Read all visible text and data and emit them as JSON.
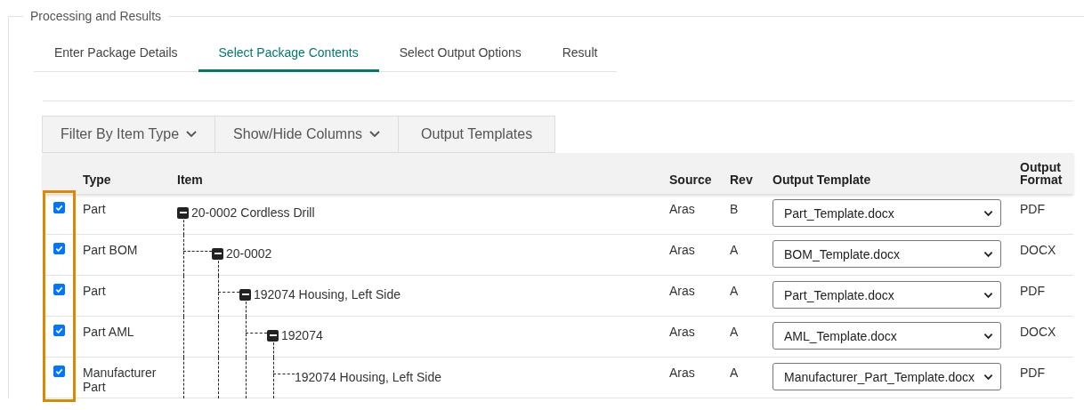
{
  "section": {
    "title": "Processing and Results"
  },
  "tabs": [
    {
      "label": "Enter Package Details",
      "selected": false
    },
    {
      "label": "Select Package Contents",
      "selected": true
    },
    {
      "label": "Select Output Options",
      "selected": false
    },
    {
      "label": "Result",
      "selected": false
    }
  ],
  "toolbar": [
    {
      "label": "Filter By Item Type",
      "dropdown": true
    },
    {
      "label": "Show/Hide Columns",
      "dropdown": true
    },
    {
      "label": "Output Templates",
      "dropdown": false
    }
  ],
  "table": {
    "columns": [
      "Type",
      "Item",
      "Source",
      "Rev",
      "Output Template",
      "Output Format"
    ],
    "tree": [
      {
        "checked": true,
        "type": "Part",
        "item": "20-0002 Cordless Drill",
        "source": "Aras",
        "rev": "B",
        "template": "Part_Template.docx",
        "format": "PDF",
        "expanded": true,
        "children": [
          {
            "checked": true,
            "type": "Part BOM",
            "item": "20-0002",
            "source": "Aras",
            "rev": "A",
            "template": "BOM_Template.docx",
            "format": "DOCX",
            "expanded": true,
            "children": [
              {
                "checked": true,
                "type": "Part",
                "item": "192074 Housing, Left Side",
                "source": "Aras",
                "rev": "A",
                "template": "Part_Template.docx",
                "format": "PDF",
                "expanded": true,
                "children": [
                  {
                    "checked": true,
                    "type": "Part AML",
                    "item": "192074",
                    "source": "Aras",
                    "rev": "A",
                    "template": "AML_Template.docx",
                    "format": "DOCX",
                    "expanded": true,
                    "children": [
                      {
                        "checked": true,
                        "type": "Manufacturer Part",
                        "item": "192074 Housing, Left Side",
                        "source": "Aras",
                        "rev": "A",
                        "template": "Manufacturer_Part_Template.docx",
                        "format": "PDF"
                      }
                    ]
                  }
                ]
              }
            ]
          }
        ]
      }
    ]
  }
}
